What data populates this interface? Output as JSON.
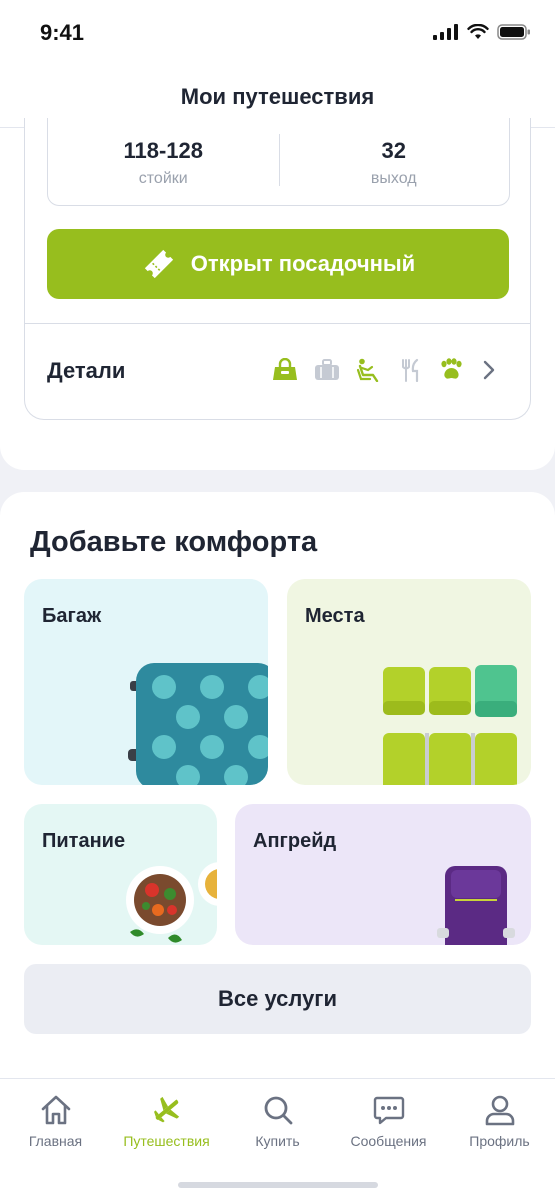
{
  "status_bar": {
    "time": "9:41"
  },
  "header": {
    "title": "Мои путешествия"
  },
  "booking": {
    "counters": {
      "value": "118-128",
      "label": "стойки"
    },
    "gate": {
      "value": "32",
      "label": "выход"
    },
    "boarding_button": "Открыт посадочный",
    "details_label": "Детали",
    "detail_icons": [
      "bag-icon",
      "suitcase-icon",
      "seat-icon",
      "meal-icon",
      "pet-icon",
      "chevron-right-icon"
    ]
  },
  "comfort": {
    "title": "Добавьте комфорта",
    "tiles": {
      "luggage": "Багаж",
      "seats": "Места",
      "food": "Питание",
      "upgrade": "Апгрейд"
    },
    "all_services": "Все услуги"
  },
  "tabbar": {
    "tabs": [
      {
        "label": "Главная",
        "icon": "home-icon"
      },
      {
        "label": "Путешествия",
        "icon": "plane-icon",
        "active": true
      },
      {
        "label": "Купить",
        "icon": "search-icon"
      },
      {
        "label": "Сообщения",
        "icon": "messages-icon"
      },
      {
        "label": "Профиль",
        "icon": "profile-icon"
      }
    ]
  },
  "colors": {
    "accent": "#97be1e",
    "text": "#1f2533",
    "muted": "#9aa1ad",
    "luggage_tile": "#e3f6f9",
    "seats_tile": "#f0f6e2",
    "food_tile": "#e4f7f4",
    "upgrade_tile": "#ece6f8"
  }
}
